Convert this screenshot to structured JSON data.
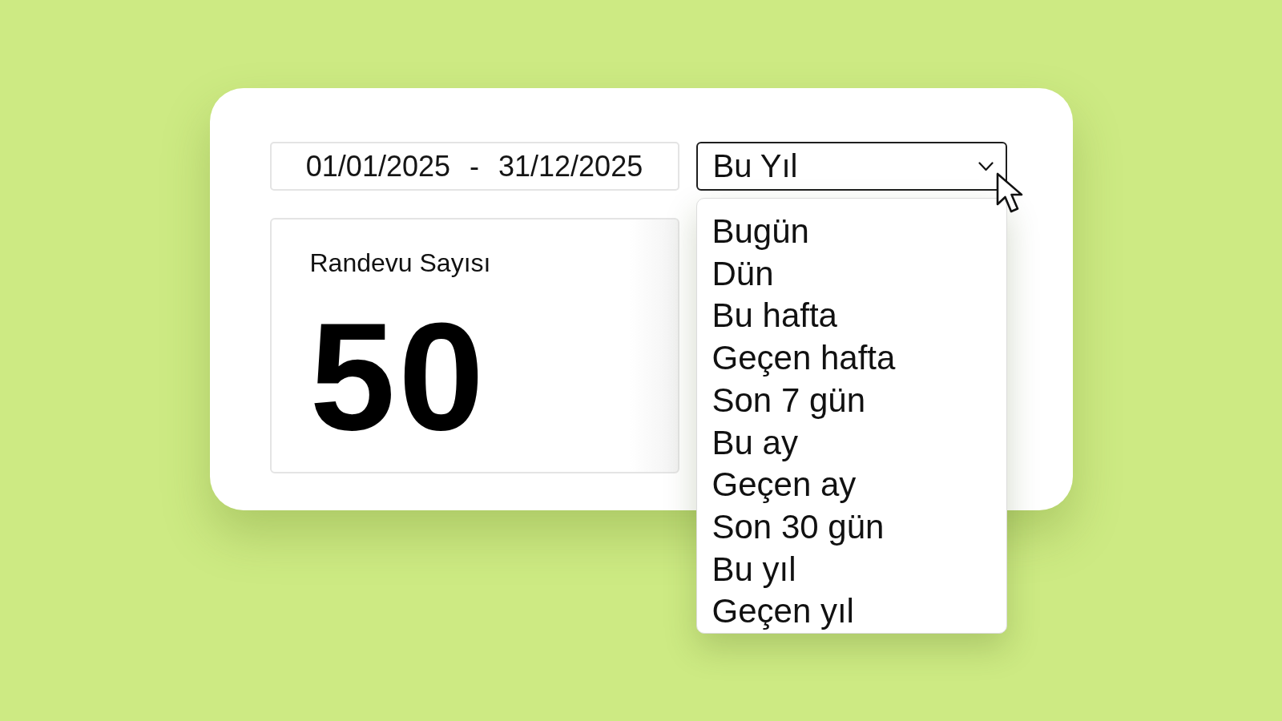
{
  "date_range": {
    "start": "01/01/2025",
    "separator": "-",
    "end": "31/12/2025"
  },
  "period_select": {
    "value": "Bu Yıl",
    "expanded": true,
    "options": [
      "Bugün",
      "Dün",
      "Bu hafta",
      "Geçen hafta",
      "Son 7 gün",
      "Bu ay",
      "Geçen ay",
      "Son 30 gün",
      "Bu yıl",
      "Geçen yıl"
    ]
  },
  "stat_card": {
    "label": "Randevu Sayısı",
    "value": "50"
  }
}
